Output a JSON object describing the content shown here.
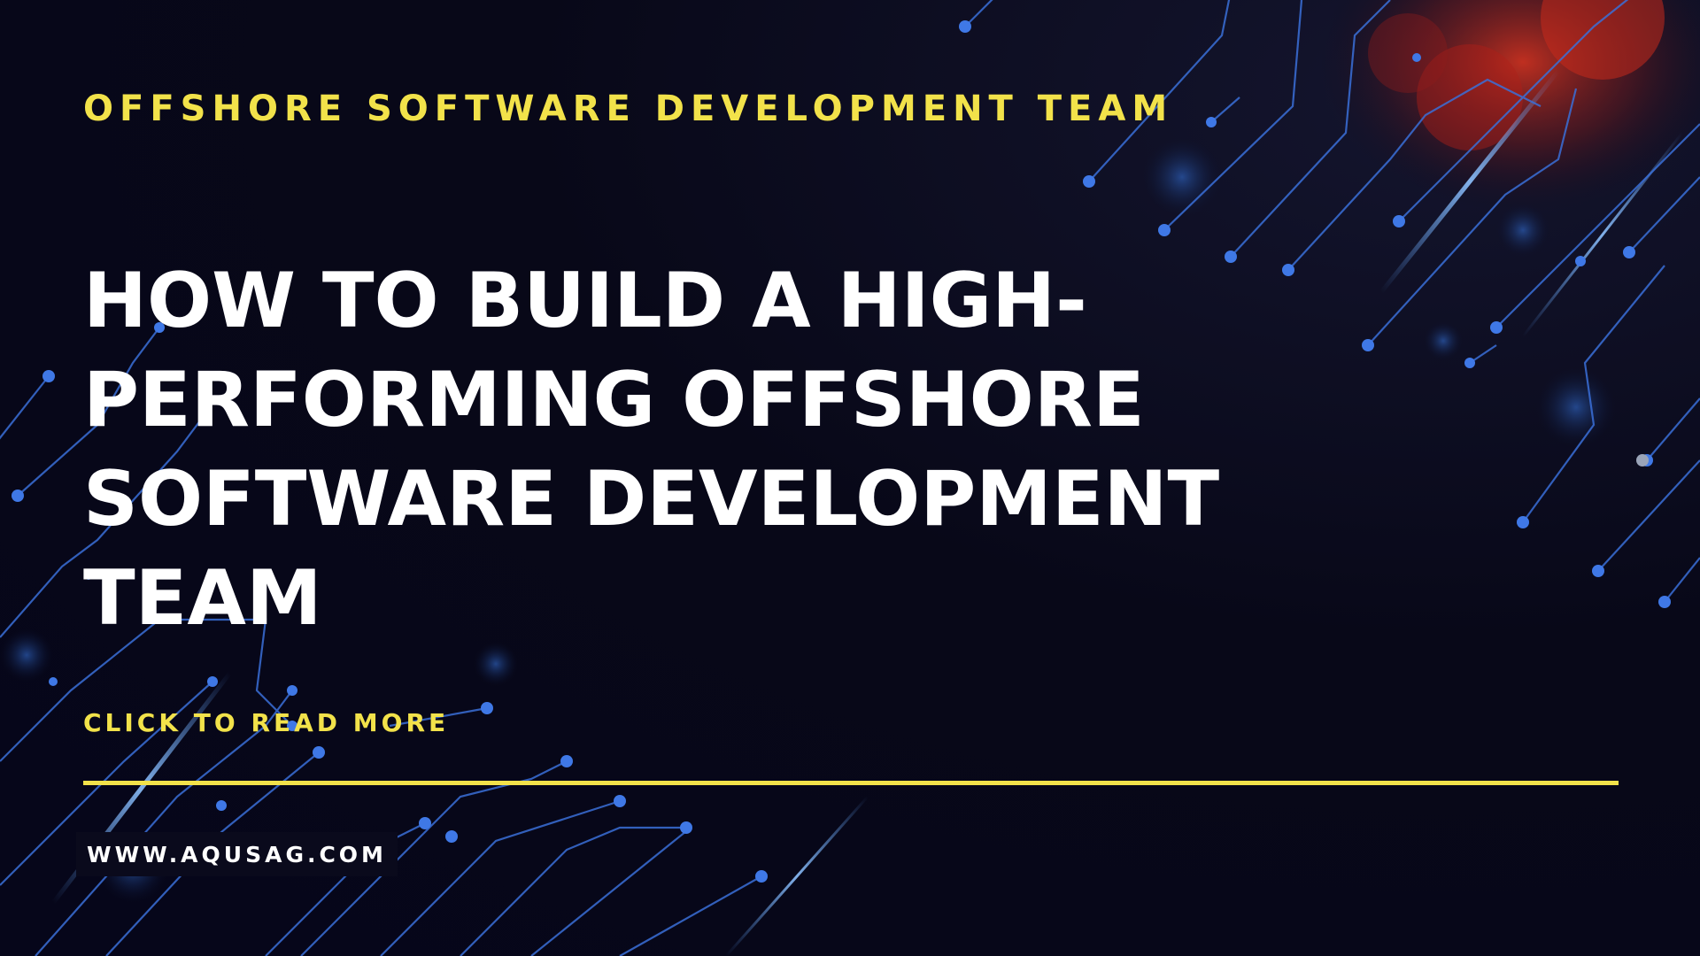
{
  "banner": {
    "eyebrow": "OFFSHORE SOFTWARE DEVELOPMENT TEAM",
    "headline_lines": [
      "HOW TO BUILD A HIGH-",
      "PERFORMING OFFSHORE",
      "SOFTWARE DEVELOPMENT",
      "TEAM"
    ],
    "cta": "CLICK TO READ MORE",
    "url": "WWW.AQUSAG.COM"
  },
  "theme": {
    "background": "#07071a",
    "accent_yellow": "#f2e24a",
    "text_white": "#ffffff",
    "circuit_blue": "#3a6fd8",
    "glow_red": "#c0281c"
  },
  "decoration": {
    "background_art": "circuit-lines-icon"
  }
}
